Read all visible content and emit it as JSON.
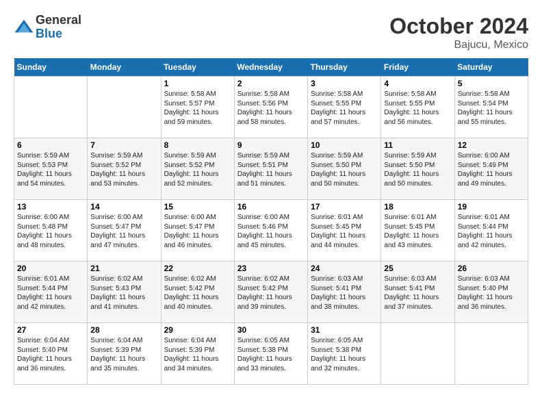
{
  "logo": {
    "general": "General",
    "blue": "Blue"
  },
  "title": {
    "month_year": "October 2024",
    "location": "Bajucu, Mexico"
  },
  "weekdays": [
    "Sunday",
    "Monday",
    "Tuesday",
    "Wednesday",
    "Thursday",
    "Friday",
    "Saturday"
  ],
  "weeks": [
    [
      {
        "day": "",
        "sunrise": "",
        "sunset": "",
        "daylight": ""
      },
      {
        "day": "",
        "sunrise": "",
        "sunset": "",
        "daylight": ""
      },
      {
        "day": "1",
        "sunrise": "Sunrise: 5:58 AM",
        "sunset": "Sunset: 5:57 PM",
        "daylight": "Daylight: 11 hours and 59 minutes."
      },
      {
        "day": "2",
        "sunrise": "Sunrise: 5:58 AM",
        "sunset": "Sunset: 5:56 PM",
        "daylight": "Daylight: 11 hours and 58 minutes."
      },
      {
        "day": "3",
        "sunrise": "Sunrise: 5:58 AM",
        "sunset": "Sunset: 5:55 PM",
        "daylight": "Daylight: 11 hours and 57 minutes."
      },
      {
        "day": "4",
        "sunrise": "Sunrise: 5:58 AM",
        "sunset": "Sunset: 5:55 PM",
        "daylight": "Daylight: 11 hours and 56 minutes."
      },
      {
        "day": "5",
        "sunrise": "Sunrise: 5:58 AM",
        "sunset": "Sunset: 5:54 PM",
        "daylight": "Daylight: 11 hours and 55 minutes."
      }
    ],
    [
      {
        "day": "6",
        "sunrise": "Sunrise: 5:59 AM",
        "sunset": "Sunset: 5:53 PM",
        "daylight": "Daylight: 11 hours and 54 minutes."
      },
      {
        "day": "7",
        "sunrise": "Sunrise: 5:59 AM",
        "sunset": "Sunset: 5:52 PM",
        "daylight": "Daylight: 11 hours and 53 minutes."
      },
      {
        "day": "8",
        "sunrise": "Sunrise: 5:59 AM",
        "sunset": "Sunset: 5:52 PM",
        "daylight": "Daylight: 11 hours and 52 minutes."
      },
      {
        "day": "9",
        "sunrise": "Sunrise: 5:59 AM",
        "sunset": "Sunset: 5:51 PM",
        "daylight": "Daylight: 11 hours and 51 minutes."
      },
      {
        "day": "10",
        "sunrise": "Sunrise: 5:59 AM",
        "sunset": "Sunset: 5:50 PM",
        "daylight": "Daylight: 11 hours and 50 minutes."
      },
      {
        "day": "11",
        "sunrise": "Sunrise: 5:59 AM",
        "sunset": "Sunset: 5:50 PM",
        "daylight": "Daylight: 11 hours and 50 minutes."
      },
      {
        "day": "12",
        "sunrise": "Sunrise: 6:00 AM",
        "sunset": "Sunset: 5:49 PM",
        "daylight": "Daylight: 11 hours and 49 minutes."
      }
    ],
    [
      {
        "day": "13",
        "sunrise": "Sunrise: 6:00 AM",
        "sunset": "Sunset: 5:48 PM",
        "daylight": "Daylight: 11 hours and 48 minutes."
      },
      {
        "day": "14",
        "sunrise": "Sunrise: 6:00 AM",
        "sunset": "Sunset: 5:47 PM",
        "daylight": "Daylight: 11 hours and 47 minutes."
      },
      {
        "day": "15",
        "sunrise": "Sunrise: 6:00 AM",
        "sunset": "Sunset: 5:47 PM",
        "daylight": "Daylight: 11 hours and 46 minutes."
      },
      {
        "day": "16",
        "sunrise": "Sunrise: 6:00 AM",
        "sunset": "Sunset: 5:46 PM",
        "daylight": "Daylight: 11 hours and 45 minutes."
      },
      {
        "day": "17",
        "sunrise": "Sunrise: 6:01 AM",
        "sunset": "Sunset: 5:45 PM",
        "daylight": "Daylight: 11 hours and 44 minutes."
      },
      {
        "day": "18",
        "sunrise": "Sunrise: 6:01 AM",
        "sunset": "Sunset: 5:45 PM",
        "daylight": "Daylight: 11 hours and 43 minutes."
      },
      {
        "day": "19",
        "sunrise": "Sunrise: 6:01 AM",
        "sunset": "Sunset: 5:44 PM",
        "daylight": "Daylight: 11 hours and 42 minutes."
      }
    ],
    [
      {
        "day": "20",
        "sunrise": "Sunrise: 6:01 AM",
        "sunset": "Sunset: 5:44 PM",
        "daylight": "Daylight: 11 hours and 42 minutes."
      },
      {
        "day": "21",
        "sunrise": "Sunrise: 6:02 AM",
        "sunset": "Sunset: 5:43 PM",
        "daylight": "Daylight: 11 hours and 41 minutes."
      },
      {
        "day": "22",
        "sunrise": "Sunrise: 6:02 AM",
        "sunset": "Sunset: 5:42 PM",
        "daylight": "Daylight: 11 hours and 40 minutes."
      },
      {
        "day": "23",
        "sunrise": "Sunrise: 6:02 AM",
        "sunset": "Sunset: 5:42 PM",
        "daylight": "Daylight: 11 hours and 39 minutes."
      },
      {
        "day": "24",
        "sunrise": "Sunrise: 6:03 AM",
        "sunset": "Sunset: 5:41 PM",
        "daylight": "Daylight: 11 hours and 38 minutes."
      },
      {
        "day": "25",
        "sunrise": "Sunrise: 6:03 AM",
        "sunset": "Sunset: 5:41 PM",
        "daylight": "Daylight: 11 hours and 37 minutes."
      },
      {
        "day": "26",
        "sunrise": "Sunrise: 6:03 AM",
        "sunset": "Sunset: 5:40 PM",
        "daylight": "Daylight: 11 hours and 36 minutes."
      }
    ],
    [
      {
        "day": "27",
        "sunrise": "Sunrise: 6:04 AM",
        "sunset": "Sunset: 5:40 PM",
        "daylight": "Daylight: 11 hours and 36 minutes."
      },
      {
        "day": "28",
        "sunrise": "Sunrise: 6:04 AM",
        "sunset": "Sunset: 5:39 PM",
        "daylight": "Daylight: 11 hours and 35 minutes."
      },
      {
        "day": "29",
        "sunrise": "Sunrise: 6:04 AM",
        "sunset": "Sunset: 5:39 PM",
        "daylight": "Daylight: 11 hours and 34 minutes."
      },
      {
        "day": "30",
        "sunrise": "Sunrise: 6:05 AM",
        "sunset": "Sunset: 5:38 PM",
        "daylight": "Daylight: 11 hours and 33 minutes."
      },
      {
        "day": "31",
        "sunrise": "Sunrise: 6:05 AM",
        "sunset": "Sunset: 5:38 PM",
        "daylight": "Daylight: 11 hours and 32 minutes."
      },
      {
        "day": "",
        "sunrise": "",
        "sunset": "",
        "daylight": ""
      },
      {
        "day": "",
        "sunrise": "",
        "sunset": "",
        "daylight": ""
      }
    ]
  ]
}
